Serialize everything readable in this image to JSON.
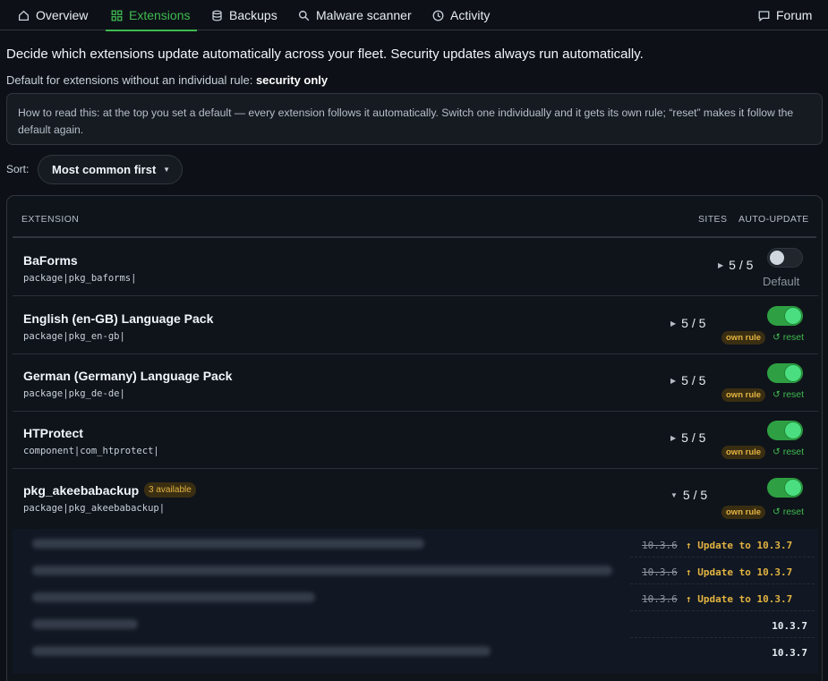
{
  "nav": {
    "tabs": [
      {
        "label": "Overview",
        "icon": "home-icon"
      },
      {
        "label": "Extensions",
        "icon": "grid-icon"
      },
      {
        "label": "Backups",
        "icon": "database-icon"
      },
      {
        "label": "Malware scanner",
        "icon": "search-icon"
      },
      {
        "label": "Activity",
        "icon": "clock-icon"
      }
    ],
    "forum": {
      "label": "Forum",
      "icon": "chat-icon"
    }
  },
  "intro": "Decide which extensions update automatically across your fleet. Security updates always run automatically.",
  "default_rule": {
    "prefix": "Default for extensions without an individual rule:",
    "value": "security only"
  },
  "howto": "How to read this: at the top you set a default — every extension follows it automatically. Switch one individually and it gets its own rule; “reset” makes it follow the default again.",
  "sort": {
    "label": "Sort:",
    "value": "Most common first"
  },
  "table": {
    "headers": {
      "extension": "EXTENSION",
      "sites": "SITES",
      "auto_update": "AUTO-UPDATE"
    },
    "rows": [
      {
        "name": "BaForms",
        "id": "package|pkg_baforms|",
        "sites": "5 / 5",
        "toggle": false,
        "state_label": "Default"
      },
      {
        "name": "English (en-GB) Language Pack",
        "id": "package|pkg_en-gb|",
        "sites": "5 / 5",
        "toggle": true,
        "badge": "own rule",
        "reset": "↺ reset"
      },
      {
        "name": "German (Germany) Language Pack",
        "id": "package|pkg_de-de|",
        "sites": "5 / 5",
        "toggle": true,
        "badge": "own rule",
        "reset": "↺ reset"
      },
      {
        "name": "HTProtect",
        "id": "component|com_htprotect|",
        "sites": "5 / 5",
        "toggle": true,
        "badge": "own rule",
        "reset": "↺ reset"
      },
      {
        "name": "pkg_akeebabackup",
        "available": "3 available",
        "id": "package|pkg_akeebabackup|",
        "sites": "5 / 5",
        "toggle": true,
        "badge": "own rule",
        "reset": "↺ reset",
        "expanded": true
      }
    ],
    "subrows": [
      {
        "old": "10.3.6",
        "action": "↑ Update to 10.3.7"
      },
      {
        "old": "10.3.6",
        "action": "↑ Update to 10.3.7"
      },
      {
        "old": "10.3.6",
        "action": "↑ Update to 10.3.7"
      },
      {
        "current": "10.3.7"
      },
      {
        "current": "10.3.7"
      }
    ]
  },
  "colors": {
    "accent": "#3fb950",
    "warning": "#e3b341",
    "background": "#0d1117"
  }
}
